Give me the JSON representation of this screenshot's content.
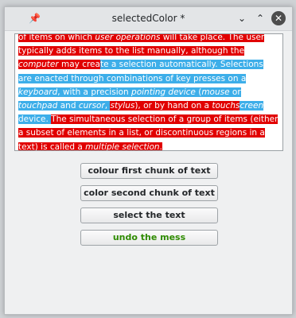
{
  "window": {
    "title": "selectedColor *",
    "pin_icon": "pin-icon",
    "minimize_icon": "chevron-down-icon",
    "maximize_icon": "chevron-up-icon",
    "close_icon": "close-icon"
  },
  "text_area": {
    "segments": [
      {
        "text": "of items on which ",
        "style": "red",
        "italic": false
      },
      {
        "text": "user operations",
        "style": "red",
        "italic": true
      },
      {
        "text": " will take place. The user typically adds items to the list manually, although the ",
        "style": "red",
        "italic": false
      },
      {
        "text": "computer",
        "style": "red",
        "italic": true
      },
      {
        "text": " may crea",
        "style": "red",
        "italic": false
      },
      {
        "text": "te a selection automatically. Selections are enacted through combinations of key presses on a ",
        "style": "blue",
        "italic": false
      },
      {
        "text": "keyboard",
        "style": "blue",
        "italic": true
      },
      {
        "text": ", with a precision ",
        "style": "blue",
        "italic": false
      },
      {
        "text": "pointing device",
        "style": "blue",
        "italic": true
      },
      {
        "text": " (",
        "style": "blue",
        "italic": false
      },
      {
        "text": "mouse",
        "style": "blue",
        "italic": true
      },
      {
        "text": " or ",
        "style": "blue",
        "italic": false
      },
      {
        "text": "touchpad",
        "style": "blue",
        "italic": true
      },
      {
        "text": " and ",
        "style": "blue",
        "italic": false
      },
      {
        "text": "cursor",
        "style": "blue",
        "italic": true
      },
      {
        "text": ", ",
        "style": "blue",
        "italic": false
      },
      {
        "text": "stylus",
        "style": "red",
        "italic": true
      },
      {
        "text": "), or by hand on a ",
        "style": "red",
        "italic": false
      },
      {
        "text": "touchs",
        "style": "red",
        "italic": true
      },
      {
        "text": "creen",
        "style": "blue",
        "italic": true
      },
      {
        "text": "  device. ",
        "style": "blue",
        "italic": false
      },
      {
        "text": "The simultaneous selection of a group of items (either a subset  of elements in a list, or discontinuous regions in a text) is called a ",
        "style": "red",
        "italic": false
      },
      {
        "text": "multiple selection",
        "style": "red",
        "italic": true
      },
      {
        "text": ".",
        "style": "red",
        "italic": false
      }
    ],
    "colors": {
      "red": "#e10000",
      "blue": "#3daee9"
    }
  },
  "buttons": {
    "colour_first": "colour first chunk of text",
    "colour_second": "color second chunk of text",
    "select_text": "select the text",
    "undo": "undo the mess"
  }
}
